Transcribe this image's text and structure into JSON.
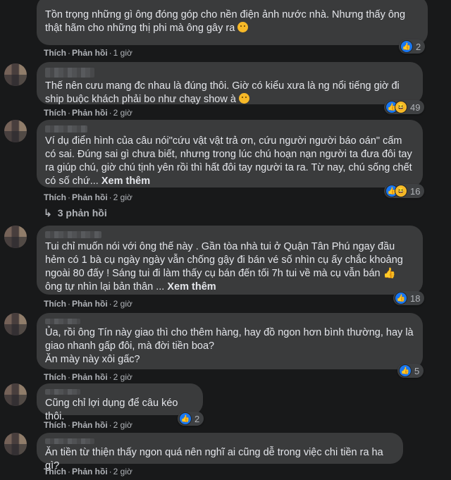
{
  "actions": {
    "like": "Thích",
    "reply": "Phản hồi",
    "sep": "·"
  },
  "comments": [
    {
      "text": "Tồn trọng những gì ông đóng góp cho nền điện ảnh nước nhà. Nhưng thấy ông thật hãm cho những thị phi mà ông gây ra",
      "time": "1 giờ",
      "reactions": {
        "types": [
          "like"
        ],
        "count": "2"
      }
    },
    {
      "text": "Thế nên cưu mang đc nhau là đúng thôi. Giờ có kiểu xưa là ng nổi tiếng giờ đi ship buộc khách phải bo như chạy show à",
      "time": "2 giờ",
      "reactions": {
        "types": [
          "like",
          "haha"
        ],
        "count": "49"
      }
    },
    {
      "text": "Ví dụ điển hình của câu nói\"cứu vật vật trả ơn, cứu người người báo oán\" cấm có sai. Đúng sai gì chưa biết, nhưng trong lúc chú hoạn nạn người ta đưa đôi tay ra giúp chú, giờ chú tịnh yên rồi thì hất đôi tay người ta ra. Từ nay, chú sống chết có số chứ...",
      "see_more": "Xem thêm",
      "time": "2 giờ",
      "reactions": {
        "types": [
          "like",
          "haha"
        ],
        "count": "16"
      },
      "replies": "3 phản hồi"
    },
    {
      "text": "Tui chỉ muốn nói với ông thế này . Gần tòa nhà tui ở Quận Tân Phú ngay đầu hẻm có 1 bà cụ ngày ngày vẫn chống gậy đi bán vé số nhìn cụ ấy chắc khoảng ngoài 80 đấy ! Sáng tui đi làm thấy cụ bán đến tối 7h tui về mà cụ vẫn bán",
      "text_after": "ông tự nhìn lại bản thân ...",
      "see_more": "Xem thêm",
      "time": "2 giờ",
      "reactions": {
        "types": [
          "like"
        ],
        "count": "18"
      }
    },
    {
      "text": "Ủa, rồi ông Tín này giao thì cho thêm hàng, hay đồ ngon hơn bình thường, hay là giao nhanh gấp đôi, mà đời tiền boa?",
      "text2": "Ăn mày này xôi gấc?",
      "time": "2 giờ",
      "reactions": {
        "types": [
          "like"
        ],
        "count": "5"
      }
    },
    {
      "text": "Cũng chỉ lợi dụng để câu kéo thôi.",
      "time": "2 giờ",
      "reactions": {
        "types": [
          "like"
        ],
        "count": "2"
      }
    },
    {
      "text": "Ăn tiền từ thiện thấy ngon quá nên nghĩ ai cũng dễ trong việc chi tiền ra ha gì?",
      "time": "2 giờ"
    }
  ]
}
